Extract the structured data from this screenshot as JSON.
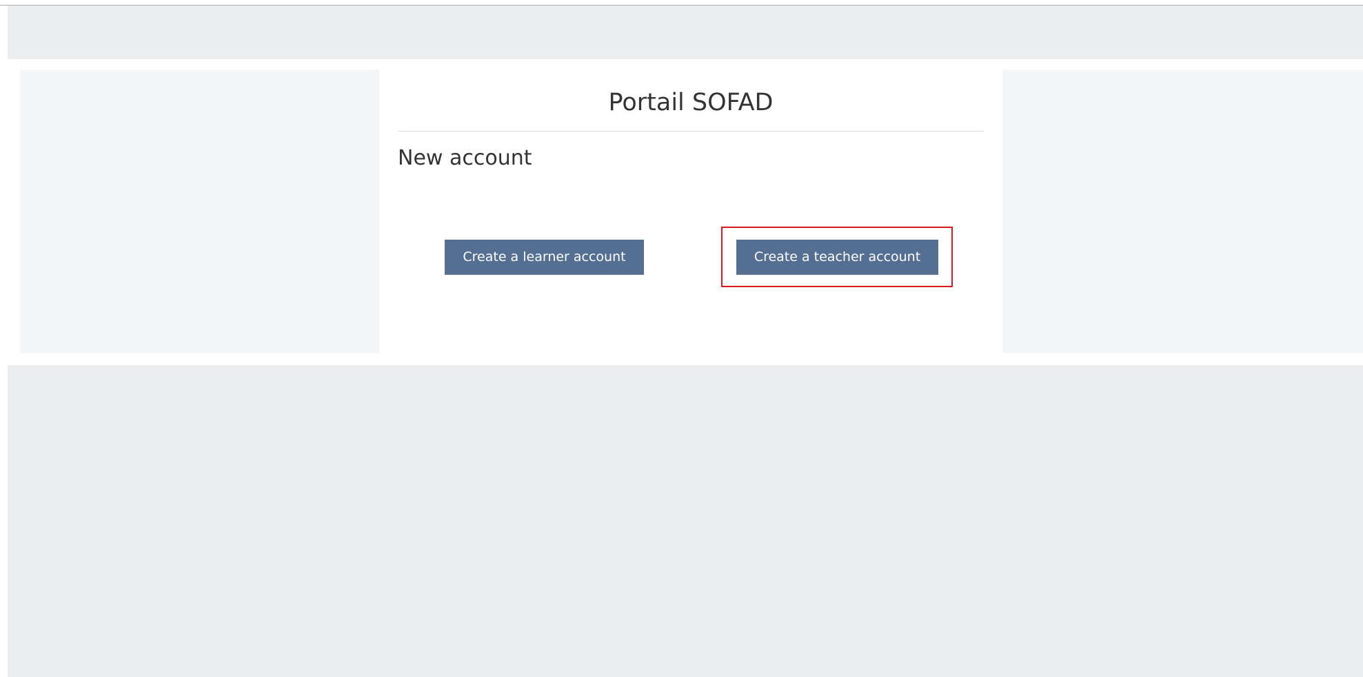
{
  "header": {
    "site_title": "Portail SOFAD"
  },
  "main": {
    "heading": "New account",
    "buttons": {
      "learner_label": "Create a learner account",
      "teacher_label": "Create a teacher account"
    }
  },
  "colors": {
    "button_bg": "#546f91",
    "page_bg": "#ecedef",
    "highlight_border": "#e0141e"
  }
}
